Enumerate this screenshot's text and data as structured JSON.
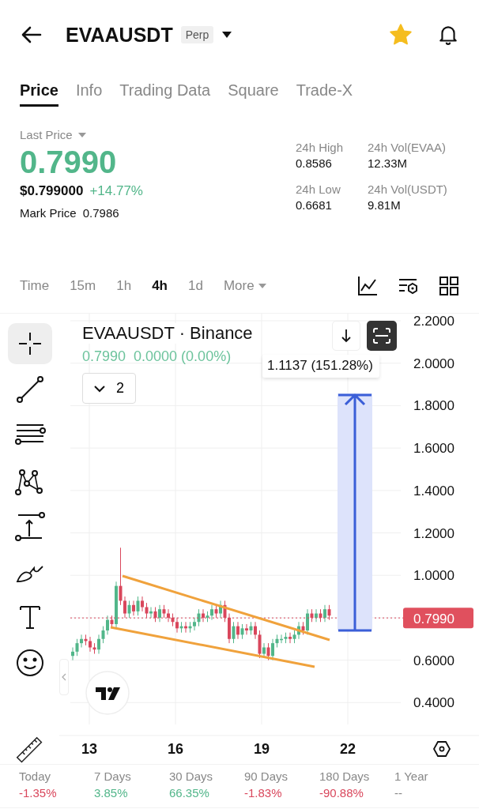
{
  "header": {
    "symbol": "EVAAUSDT",
    "badge": "Perp",
    "favorite": true
  },
  "tabs": [
    {
      "label": "Price",
      "selected": true
    },
    {
      "label": "Info",
      "selected": false
    },
    {
      "label": "Trading Data",
      "selected": false
    },
    {
      "label": "Square",
      "selected": false
    },
    {
      "label": "Trade-X",
      "selected": false
    }
  ],
  "price": {
    "selector_label": "Last Price",
    "last_price": "0.7990",
    "usd_price": "$0.799000",
    "change": "+14.77%",
    "mark_price_label": "Mark Price",
    "mark_price": "0.7986"
  },
  "stats": [
    {
      "label": "24h High",
      "value": "0.8586"
    },
    {
      "label": "24h Vol(EVAA)",
      "value": "12.33M"
    },
    {
      "label": "24h Low",
      "value": "0.6681"
    },
    {
      "label": "24h Vol(USDT)",
      "value": "9.81M"
    }
  ],
  "intervals": [
    {
      "label": "Time",
      "kind": "option",
      "selected": false
    },
    {
      "label": "15m",
      "kind": "option",
      "selected": false
    },
    {
      "label": "1h",
      "kind": "option",
      "selected": false
    },
    {
      "label": "4h",
      "kind": "option",
      "selected": true
    },
    {
      "label": "1d",
      "kind": "option",
      "selected": false
    },
    {
      "label": "More",
      "kind": "dropdown",
      "selected": false
    }
  ],
  "tools": [
    {
      "kind": "crosshair",
      "selected": true
    },
    {
      "kind": "line",
      "selected": false
    },
    {
      "kind": "parallel",
      "selected": false
    },
    {
      "kind": "pattern",
      "selected": false
    },
    {
      "kind": "measure",
      "selected": false
    },
    {
      "kind": "brush",
      "selected": false
    },
    {
      "kind": "text",
      "selected": false
    },
    {
      "kind": "emoji",
      "selected": false
    }
  ],
  "chart": {
    "legend_title": "EVAAUSDT · Binance",
    "legend_price": "0.7990",
    "legend_change": "0.0000 (0.00%)",
    "indicator_count": "2",
    "measure_label": "1.1137 (151.28%)",
    "price_tag": "0.7990",
    "y_axis_labels": [
      "2.2000",
      "2.0000",
      "1.8000",
      "1.6000",
      "1.4000",
      "1.2000",
      "1.0000",
      "0.6000",
      "0.4000"
    ],
    "x_axis_labels": [
      "13",
      "16",
      "19",
      "22"
    ]
  },
  "period_returns": [
    {
      "label": "Today",
      "value": "-1.35%",
      "color": "#d9475c"
    },
    {
      "label": "7 Days",
      "value": "3.85%",
      "color": "#52b68a"
    },
    {
      "label": "30 Days",
      "value": "66.35%",
      "color": "#52b68a"
    },
    {
      "label": "90 Days",
      "value": "-1.83%",
      "color": "#d9475c"
    },
    {
      "label": "180 Days",
      "value": "-90.88%",
      "color": "#d9475c"
    },
    {
      "label": "1 Year",
      "value": "--",
      "color": "#888888"
    }
  ]
}
